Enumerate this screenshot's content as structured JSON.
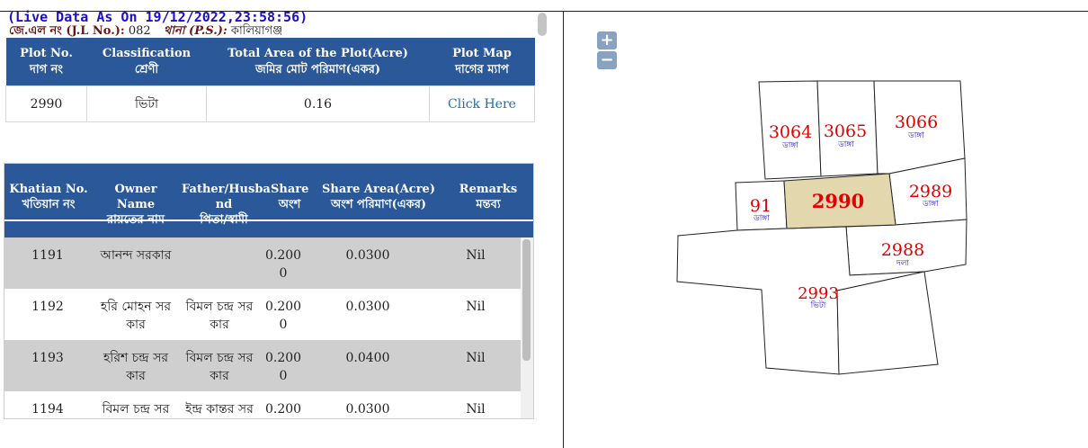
{
  "header": {
    "live_data": "(Live Data As On 19/12/2022,23:58:56)",
    "jl_label": "জে.এল নং (J.L No.):",
    "jl_value": "082",
    "ps_label": "থানা (P.S.):",
    "ps_value": "কালিয়াগঞ্জ"
  },
  "plot_table": {
    "headers": [
      {
        "en": "Plot No.",
        "bn": "দাগ নং"
      },
      {
        "en": "Classification",
        "bn": "শ্রেণী"
      },
      {
        "en": "Total Area of the Plot(Acre)",
        "bn": "জমির মোট পরিমাণ(একর)"
      },
      {
        "en": "Plot Map",
        "bn": "দাগের ম্যাপ"
      }
    ],
    "row": {
      "plot_no": "2990",
      "classification": "ভিটা",
      "area": "0.16",
      "map_link": "Click Here"
    }
  },
  "owner_table": {
    "headers": [
      {
        "en": "Khatian No.",
        "bn": "খতিয়ান নং"
      },
      {
        "en": "Owner Name",
        "bn": "রায়তের নাম"
      },
      {
        "en": "Father/Husba nd",
        "bn": "পিতা/স্বামী"
      },
      {
        "en": "Share",
        "bn": "অংশ"
      },
      {
        "en": "Share Area(Acre)",
        "bn": "অংশ পরিমাণ(একর)"
      },
      {
        "en": "Remarks",
        "bn": "মন্তব্য"
      }
    ],
    "rows": [
      {
        "khatian": "1191",
        "owner": "আনন্দ সরকার",
        "father": "",
        "share": "0.200 0",
        "share_area": "0.0300",
        "remarks": "Nil"
      },
      {
        "khatian": "1192",
        "owner": "হরি মোহন সর কার",
        "father": "বিমল চন্দ্র সর কার",
        "share": "0.200 0",
        "share_area": "0.0300",
        "remarks": "Nil"
      },
      {
        "khatian": "1193",
        "owner": "হরিশ চন্দ্র সর কার",
        "father": "বিমল চন্দ্র সর কার",
        "share": "0.200 0",
        "share_area": "0.0400",
        "remarks": "Nil"
      },
      {
        "khatian": "1194",
        "owner": "বিমল চন্দ্র সর",
        "father": "ইন্দ্র কান্তর সর",
        "share": "0.200",
        "share_area": "0.0300",
        "remarks": "Nil"
      }
    ]
  },
  "map": {
    "zoom_in": "+",
    "zoom_out": "−",
    "selected_fill": "#e3d7ae",
    "plots": [
      {
        "no": "3064",
        "class": "ডাঙ্গা"
      },
      {
        "no": "3065",
        "class": "ডাঙ্গা"
      },
      {
        "no": "3066",
        "class": "ডাঙ্গা"
      },
      {
        "no": "91",
        "class": "ডাঙ্গা"
      },
      {
        "no": "2990",
        "class": ""
      },
      {
        "no": "2989",
        "class": "ডাঙ্গা"
      },
      {
        "no": "2988",
        "class": "দলা"
      },
      {
        "no": "2993",
        "class": "ভিটা"
      }
    ]
  }
}
